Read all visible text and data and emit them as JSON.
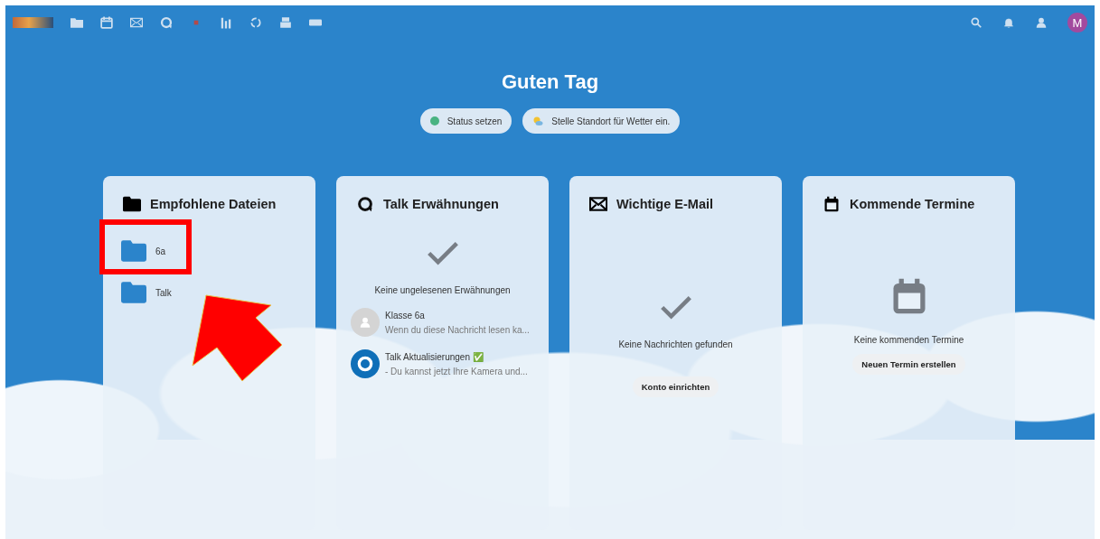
{
  "header": {
    "avatar_initial": "M"
  },
  "greeting": "Guten Tag",
  "status_pills": [
    {
      "kind": "status",
      "label": "Status setzen",
      "color": "#49b382"
    },
    {
      "kind": "weather",
      "label": "Stelle Standort für Wetter ein."
    }
  ],
  "widgets": [
    {
      "kind": "files",
      "title": "Empfohlene Dateien",
      "items": [
        {
          "name": "6a",
          "highlighted": true
        },
        {
          "name": "Talk",
          "highlighted": false
        }
      ]
    },
    {
      "kind": "talk",
      "title": "Talk Erwähnungen",
      "empty_text": "Keine ungelesenen Erwähnungen",
      "items": [
        {
          "kind": "placeholder",
          "title": "Klasse 6a",
          "subtitle": "Wenn du diese Nachricht lesen ka..."
        },
        {
          "kind": "talk",
          "title": "Talk Aktualisierungen ✅",
          "subtitle": "- Du kannst jetzt Ihre Kamera und..."
        }
      ]
    },
    {
      "kind": "mail",
      "title": "Wichtige E-Mail",
      "empty_text": "Keine Nachrichten gefunden",
      "button": "Konto einrichten"
    },
    {
      "kind": "calendar",
      "title": "Kommende Termine",
      "empty_text": "Keine kommenden Termine",
      "button": "Neuen Termin erstellen"
    }
  ],
  "arrow_annotation": true
}
